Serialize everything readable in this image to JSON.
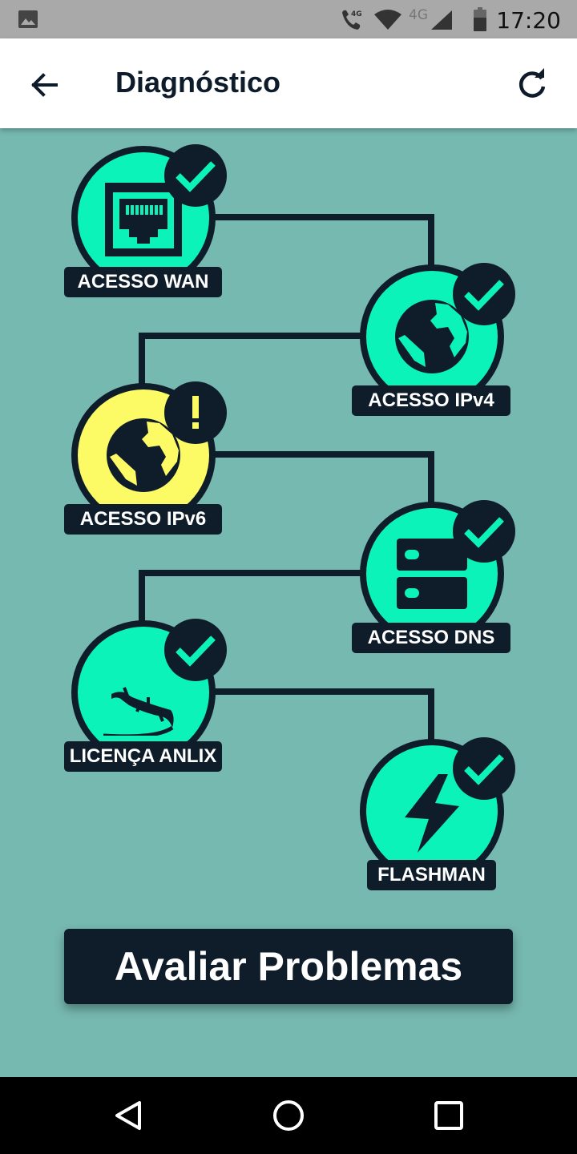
{
  "status_bar": {
    "time": "17:20",
    "call_network_label": "4G",
    "mobile_network_label": "4G",
    "icons": [
      "image-icon",
      "wifi-call-icon",
      "wifi-icon",
      "signal-icon",
      "battery-icon"
    ]
  },
  "app_bar": {
    "title": "Diagnóstico",
    "icons": [
      "arrow-back-icon",
      "refresh-icon"
    ]
  },
  "diagnostics": [
    {
      "label": "ACESSO WAN",
      "status": "ok",
      "icon": "ethernet-port-icon",
      "color": "#0bf3b8"
    },
    {
      "label": "ACESSO IPv4",
      "status": "ok",
      "icon": "globe-icon",
      "color": "#0bf3b8"
    },
    {
      "label": "ACESSO IPv6",
      "status": "warning",
      "icon": "globe-icon",
      "color": "#fcfb66"
    },
    {
      "label": "ACESSO DNS",
      "status": "ok",
      "icon": "server-icon",
      "color": "#0bf3b8"
    },
    {
      "label": "LICENÇA ANLIX",
      "status": "ok",
      "icon": "lizard-icon",
      "color": "#0bf3b8"
    },
    {
      "label": "FLASHMAN",
      "status": "ok",
      "icon": "lightning-icon",
      "color": "#0bf3b8"
    }
  ],
  "primary_action": {
    "label": "Avaliar Problemas"
  },
  "colors": {
    "background": "#76b9b1",
    "dark": "#0f1c2a",
    "ok": "#0bf3b8",
    "warning": "#fcfb66"
  },
  "nav_bar": {
    "icons": [
      "back-triangle-icon",
      "home-circle-icon",
      "recents-square-icon"
    ]
  }
}
